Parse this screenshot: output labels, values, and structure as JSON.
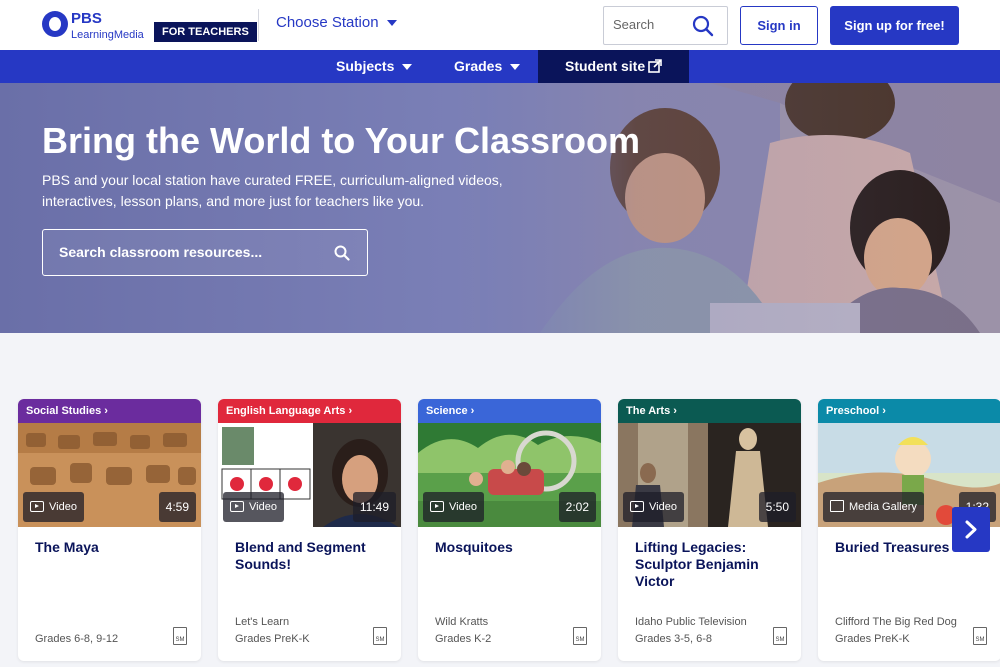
{
  "header": {
    "logo_pbs": "PBS",
    "logo_sub": "LearningMedia",
    "badge": "FOR TEACHERS",
    "station": "Choose Station",
    "search_placeholder": "Search",
    "signin": "Sign in",
    "signup": "Sign up for free!"
  },
  "nav": {
    "subjects": "Subjects",
    "grades": "Grades",
    "student_site": "Student site"
  },
  "hero": {
    "title": "Bring the World to Your Classroom",
    "subtitle": "PBS and your local station have curated FREE, curriculum-aligned videos, interactives, lesson plans, and more just for teachers like you.",
    "search_placeholder": "Search classroom resources..."
  },
  "cards": [
    {
      "category": "Social Studies",
      "color": "#6b2c9e",
      "media": "Video",
      "duration": "4:59",
      "title": "The Maya",
      "producer": "",
      "grades": "Grades 6-8, 9-12"
    },
    {
      "category": "English Language Arts",
      "color": "#e0283c",
      "media": "Video",
      "duration": "11:49",
      "title": "Blend and Segment Sounds!",
      "producer": "Let's Learn",
      "grades": "Grades PreK-K"
    },
    {
      "category": "Science",
      "color": "#3a66d8",
      "media": "Video",
      "duration": "2:02",
      "title": "Mosquitoes",
      "producer": "Wild Kratts",
      "grades": "Grades K-2"
    },
    {
      "category": "The Arts",
      "color": "#0b5a52",
      "media": "Video",
      "duration": "5:50",
      "title": "Lifting Legacies: Sculptor Benjamin Victor",
      "producer": "Idaho Public Television",
      "grades": "Grades 3-5, 6-8"
    },
    {
      "category": "Preschool",
      "color": "#0b8aa8",
      "media": "Media Gallery",
      "duration": "1:32",
      "title": "Buried Treasures",
      "producer": "Clifford The Big Red Dog",
      "grades": "Grades PreK-K"
    }
  ],
  "doc_icon_label": "SM",
  "colors": {
    "brand": "#2638c4",
    "navy": "#0a145a"
  }
}
